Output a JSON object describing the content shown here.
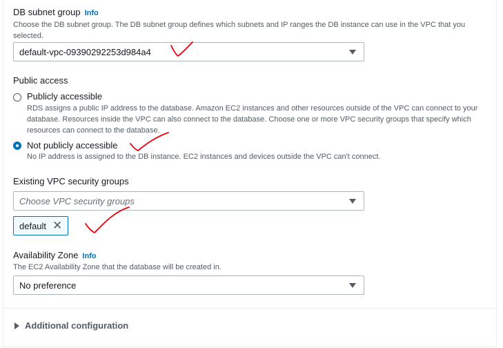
{
  "subnet": {
    "label": "DB subnet group",
    "info": "Info",
    "desc_line1": "Choose the DB subnet group. The DB subnet group defines which subnets and IP ranges the DB instance can use in the VPC that you",
    "desc_line2": "selected.",
    "value": "default-vpc-09390292253d984a4"
  },
  "public_access": {
    "label": "Public access",
    "options": [
      {
        "label": "Publicly accessible",
        "selected": false,
        "desc_lines": [
          "RDS assigns a public IP address to the database. Amazon EC2 instances and other resources outside of the VPC can connect to your",
          "database. Resources inside the VPC can also connect to the database. Choose one or more VPC security groups that specify which",
          "resources can connect to the database."
        ]
      },
      {
        "label": "Not publicly accessible",
        "selected": true,
        "desc_lines": [
          "No IP address is assigned to the DB instance. EC2 instances and devices outside the VPC can't connect."
        ]
      }
    ]
  },
  "security_groups": {
    "label": "Existing VPC security groups",
    "placeholder": "Choose VPC security groups",
    "tokens": [
      "default"
    ],
    "remove_glyph": "✕"
  },
  "availability_zone": {
    "label": "Availability Zone",
    "info": "Info",
    "desc": "The EC2 Availability Zone that the database will be created in.",
    "value": "No preference"
  },
  "additional": {
    "label": "Additional configuration"
  },
  "colors": {
    "link": "#0073bb",
    "annotation": "#e8000b"
  }
}
